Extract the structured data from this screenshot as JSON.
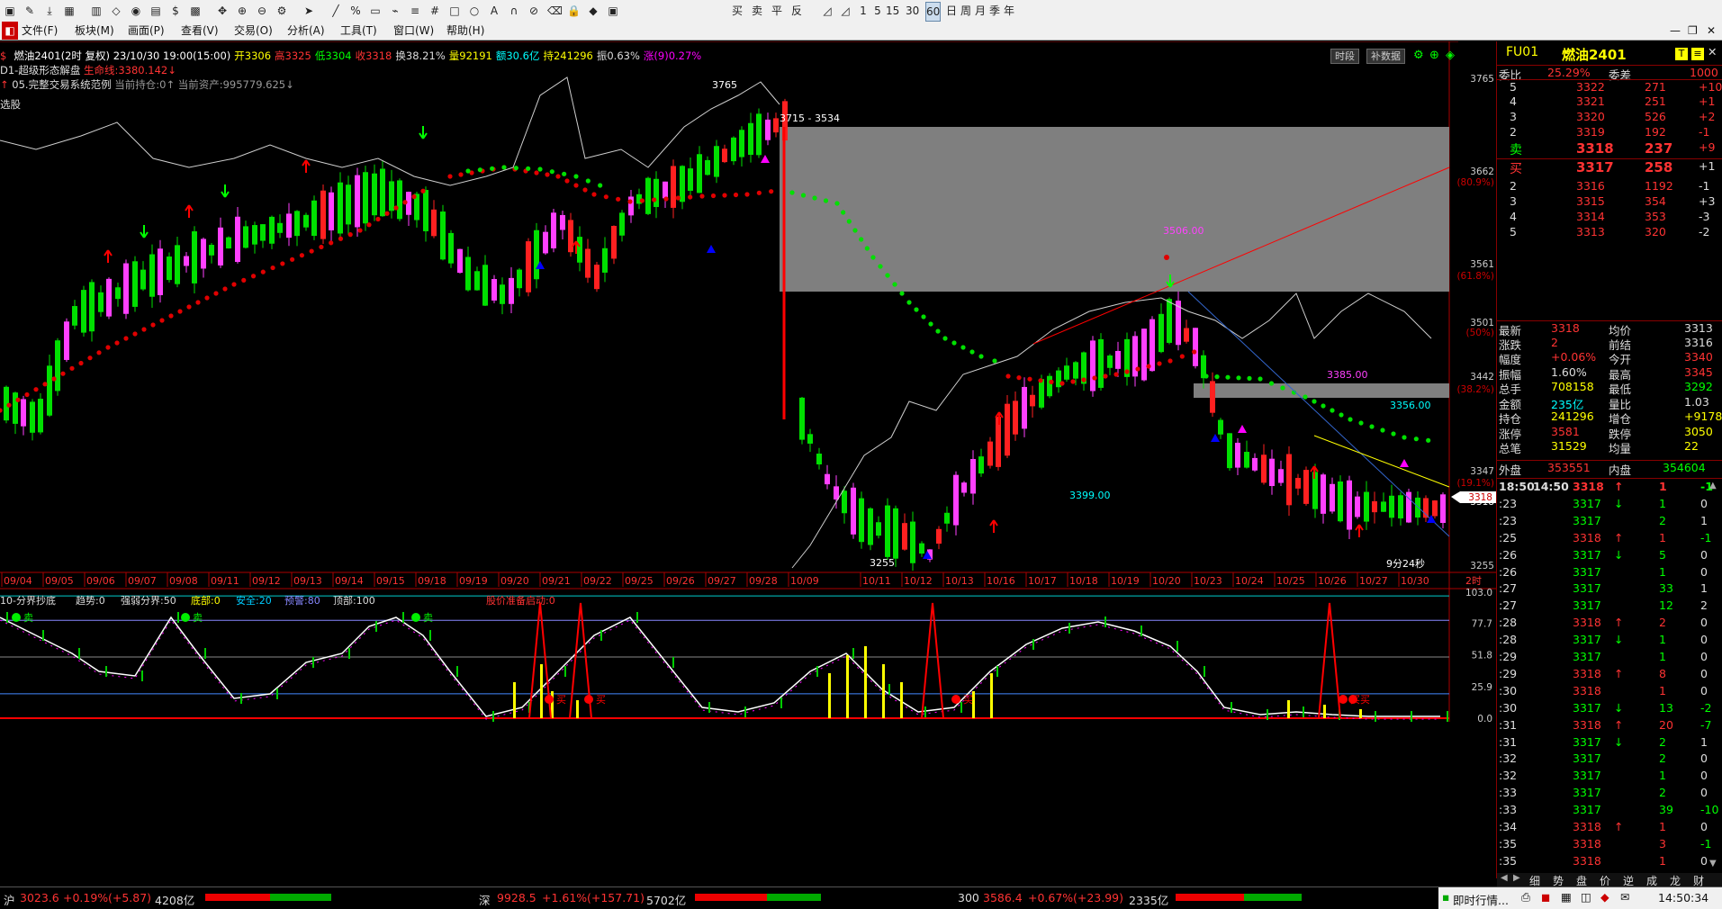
{
  "toolbar": {
    "icons": [
      "app-icon",
      "pen-icon",
      "download-icon",
      "grid-icon",
      "bars-icon",
      "diamond-icon",
      "circle-icon",
      "image-icon",
      "dollar-icon",
      "calc-icon",
      "move-icon",
      "zoom-in-icon",
      "zoom-out-icon",
      "gear-icon",
      "cursor-icon",
      "line-icon",
      "percent-icon",
      "channel-icon",
      "draw-icon",
      "fib-icon",
      "grid2-icon",
      "rect-icon",
      "ellipse-icon",
      "text-icon",
      "magnet-icon",
      "link-icon",
      "erase-icon",
      "lock-icon",
      "color-icon",
      "save-icon"
    ],
    "buttons": [
      "买",
      "卖",
      "平",
      "反"
    ],
    "periods": [
      "1",
      "5",
      "15",
      "30",
      "60",
      "日",
      "周",
      "月",
      "季",
      "年"
    ]
  },
  "menu": [
    "文件(F)",
    "板块(M)",
    "画面(P)",
    "查看(V)",
    "交易(O)",
    "分析(A)",
    "工具(T)",
    "窗口(W)",
    "帮助(H)"
  ],
  "quote_line": {
    "symbol": "燃油2401(2时 复权) 23/10/30 19:00(15:00)",
    "open": "开3306",
    "high": "高3325",
    "low": "低3304",
    "close": "收3318",
    "turnover": "换38.21%",
    "volume": "量92191",
    "amount": "额30.6亿",
    "hold": "持241296",
    "amp": "振0.63%",
    "change": "涨(9)0.27%"
  },
  "indicator1": {
    "name": "D1-超级形态解盘",
    "life": "生命线:3380.142↓"
  },
  "indicator2": {
    "name": "05.完整交易系统范例",
    "position": "当前持仓:0↑",
    "assets": "当前资产:995779.625↓"
  },
  "xuangu": "选股",
  "top_buttons": [
    "时段",
    "补数据"
  ],
  "chart_labels": {
    "box_label": "3715 - 3534",
    "high_label": "3765",
    "low_label": "3255",
    "lbl_3399": "3399.00",
    "lbl_3356": "3356.00",
    "lbl_3385": "3385.00",
    "lbl_3506": "3506.00",
    "countdown": "9分24秒"
  },
  "price_axis": [
    {
      "v": "3765",
      "c": "#ccc"
    },
    {
      "v": "3662",
      "c": "#ccc"
    },
    {
      "v": "(80.9%)",
      "c": "#c00"
    },
    {
      "v": "3561",
      "c": "#ccc"
    },
    {
      "v": "(61.8%)",
      "c": "#c00"
    },
    {
      "v": "3501",
      "c": "#ccc"
    },
    {
      "v": "(50%)",
      "c": "#c00"
    },
    {
      "v": "3442",
      "c": "#ccc"
    },
    {
      "v": "(38.2%)",
      "c": "#c00"
    },
    {
      "v": "3347",
      "c": "#ccc"
    },
    {
      "v": "(19.1%)",
      "c": "#c00"
    },
    {
      "v": "3318",
      "c": "#fff"
    },
    {
      "v": "3255",
      "c": "#ccc"
    }
  ],
  "date_axis": [
    "09/04",
    "09/05",
    "09/06",
    "09/07",
    "09/08",
    "09/11",
    "09/12",
    "09/13",
    "09/14",
    "09/15",
    "09/18",
    "09/19",
    "09/20",
    "09/21",
    "09/22",
    "09/25",
    "09/26",
    "09/27",
    "09/28",
    "10/09",
    "10/11",
    "10/12",
    "10/13",
    "10/16",
    "10/17",
    "10/18",
    "10/19",
    "10/20",
    "10/23",
    "10/24",
    "10/25",
    "10/26",
    "10/27",
    "10/30"
  ],
  "period_label": "2时",
  "lower": {
    "title": "10-分界抄底",
    "trend": "趋势:0",
    "strong": "强弱分界:50",
    "bottom": "底部:0",
    "safe": "安全:20",
    "warn": "预警:80",
    "top": "顶部:100",
    "alert": "股价准备启动:0",
    "axis": [
      "103.0",
      "77.7",
      "51.8",
      "25.9",
      "0.0"
    ],
    "sell_labels": [
      "卖",
      "卖",
      "卖"
    ],
    "buy_labels": [
      "买",
      "买",
      "买",
      "买",
      "买"
    ]
  },
  "panel": {
    "code": "FU01",
    "name": "燃油2401",
    "ratio_label": "委比",
    "ratio": "25.29%",
    "diff_label": "委差",
    "diff": "1000",
    "asks": [
      {
        "lvl": "5",
        "price": "3322",
        "vol": "271",
        "chg": "+10"
      },
      {
        "lvl": "4",
        "price": "3321",
        "vol": "251",
        "chg": "+1"
      },
      {
        "lvl": "3",
        "price": "3320",
        "vol": "526",
        "chg": "+2"
      },
      {
        "lvl": "2",
        "price": "3319",
        "vol": "192",
        "chg": "-1"
      },
      {
        "lvl": "卖",
        "price": "3318",
        "vol": "237",
        "chg": "+9"
      }
    ],
    "bids": [
      {
        "lvl": "买",
        "price": "3317",
        "vol": "258",
        "chg": "+1"
      },
      {
        "lvl": "2",
        "price": "3316",
        "vol": "1192",
        "chg": "-1"
      },
      {
        "lvl": "3",
        "price": "3315",
        "vol": "354",
        "chg": "+3"
      },
      {
        "lvl": "4",
        "price": "3314",
        "vol": "353",
        "chg": "-3"
      },
      {
        "lvl": "5",
        "price": "3313",
        "vol": "320",
        "chg": "-2"
      }
    ],
    "stats": [
      {
        "l": "最新",
        "v": "3318",
        "vc": "#f33",
        "l2": "均价",
        "v2": "3313",
        "v2c": "#ddd"
      },
      {
        "l": "涨跌",
        "v": "2",
        "vc": "#f33",
        "l2": "前结",
        "v2": "3316",
        "v2c": "#ddd"
      },
      {
        "l": "幅度",
        "v": "+0.06%",
        "vc": "#f33",
        "l2": "今开",
        "v2": "3340",
        "v2c": "#f33"
      },
      {
        "l": "振幅",
        "v": "1.60%",
        "vc": "#ddd",
        "l2": "最高",
        "v2": "3345",
        "v2c": "#f33"
      },
      {
        "l": "总手",
        "v": "708158",
        "vc": "#ff0",
        "l2": "最低",
        "v2": "3292",
        "v2c": "#0f0"
      },
      {
        "l": "金额",
        "v": "235亿",
        "vc": "#0ff",
        "l2": "量比",
        "v2": "1.03",
        "v2c": "#ddd"
      },
      {
        "l": "持仓",
        "v": "241296",
        "vc": "#ff0",
        "l2": "增仓",
        "v2": "+9178",
        "v2c": "#ff0"
      },
      {
        "l": "涨停",
        "v": "3581",
        "vc": "#f33",
        "l2": "跌停",
        "v2": "3050",
        "v2c": "#ff0"
      },
      {
        "l": "总笔",
        "v": "31529",
        "vc": "#ff0",
        "l2": "均量",
        "v2": "22",
        "v2c": "#ff0"
      }
    ],
    "outer_label": "外盘",
    "outer": "353551",
    "inner_label": "内盘",
    "inner": "354604",
    "ticks": [
      {
        "t": "18:50",
        "t2": "14:50",
        "p": "3318",
        "d": "↑",
        "v": "1",
        "c": "-1"
      },
      {
        "t": ":23",
        "t2": "",
        "p": "3317",
        "d": "↓",
        "v": "1",
        "c": "0"
      },
      {
        "t": ":23",
        "t2": "",
        "p": "3317",
        "d": "",
        "v": "2",
        "c": "1"
      },
      {
        "t": ":25",
        "t2": "",
        "p": "3318",
        "d": "↑",
        "v": "1",
        "c": "-1"
      },
      {
        "t": ":26",
        "t2": "",
        "p": "3317",
        "d": "↓",
        "v": "5",
        "c": "0"
      },
      {
        "t": ":26",
        "t2": "",
        "p": "3317",
        "d": "",
        "v": "1",
        "c": "0"
      },
      {
        "t": ":27",
        "t2": "",
        "p": "3317",
        "d": "",
        "v": "33",
        "c": "1"
      },
      {
        "t": ":27",
        "t2": "",
        "p": "3317",
        "d": "",
        "v": "12",
        "c": "2"
      },
      {
        "t": ":28",
        "t2": "",
        "p": "3318",
        "d": "↑",
        "v": "2",
        "c": "0"
      },
      {
        "t": ":28",
        "t2": "",
        "p": "3317",
        "d": "↓",
        "v": "1",
        "c": "0"
      },
      {
        "t": ":29",
        "t2": "",
        "p": "3317",
        "d": "",
        "v": "1",
        "c": "0"
      },
      {
        "t": ":29",
        "t2": "",
        "p": "3318",
        "d": "↑",
        "v": "8",
        "c": "0"
      },
      {
        "t": ":30",
        "t2": "",
        "p": "3318",
        "d": "",
        "v": "1",
        "c": "0"
      },
      {
        "t": ":30",
        "t2": "",
        "p": "3317",
        "d": "↓",
        "v": "13",
        "c": "-2"
      },
      {
        "t": ":31",
        "t2": "",
        "p": "3318",
        "d": "↑",
        "v": "20",
        "c": "-7"
      },
      {
        "t": ":31",
        "t2": "",
        "p": "3317",
        "d": "↓",
        "v": "2",
        "c": "1"
      },
      {
        "t": ":32",
        "t2": "",
        "p": "3317",
        "d": "",
        "v": "2",
        "c": "0"
      },
      {
        "t": ":32",
        "t2": "",
        "p": "3317",
        "d": "",
        "v": "1",
        "c": "0"
      },
      {
        "t": ":33",
        "t2": "",
        "p": "3317",
        "d": "",
        "v": "2",
        "c": "0"
      },
      {
        "t": ":33",
        "t2": "",
        "p": "3317",
        "d": "",
        "v": "39",
        "c": "-10"
      },
      {
        "t": ":34",
        "t2": "",
        "p": "3318",
        "d": "↑",
        "v": "1",
        "c": "0"
      },
      {
        "t": ":35",
        "t2": "",
        "p": "3318",
        "d": "",
        "v": "3",
        "c": "-1"
      },
      {
        "t": ":35",
        "t2": "",
        "p": "3318",
        "d": "",
        "v": "1",
        "c": "0"
      }
    ],
    "tabs": [
      "细",
      "势",
      "盘",
      "价",
      "逆",
      "成",
      "龙",
      "财"
    ]
  },
  "status": {
    "sh_label": "沪",
    "sh_val": "3023.6",
    "sh_chg": "+0.19%",
    "sh_pts": "(+5.87)",
    "sh_amt": "4208亿",
    "sz_label": "深",
    "sz_val": "9928.5",
    "sz_chg": "+1.61%",
    "sz_pts": "(+157.71)",
    "sz_amt": "5702亿",
    "c3_label": "300",
    "c3_val": "3586.4",
    "c3_chg": "+0.67%",
    "c3_pts": "(+23.99)",
    "c3_amt": "2335亿",
    "realtime": "即时行情...",
    "clock": "14:50:34"
  }
}
